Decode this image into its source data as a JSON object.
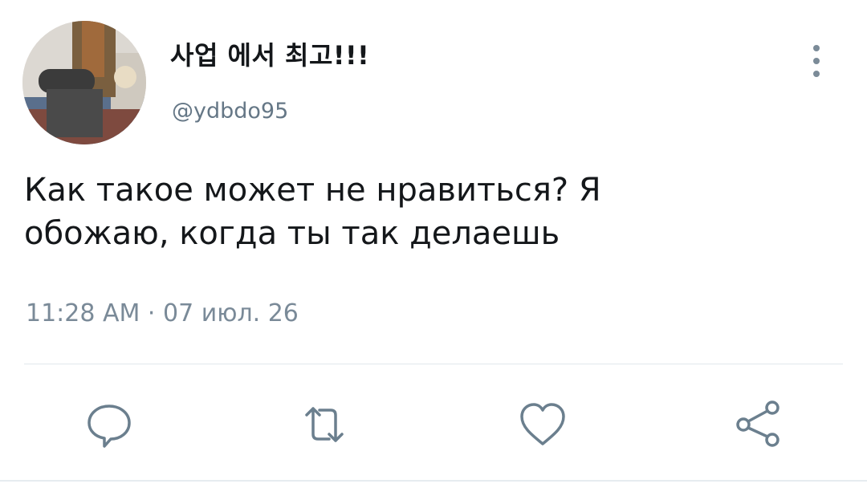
{
  "tweet": {
    "display_name": "사업 에서 최고!!!",
    "handle": "@ydbdo95",
    "text_line1": "Как такое может не нравиться? Я",
    "text_line2": "обожаю, когда ты так делаешь",
    "timestamp": "11:28 AM · 07 июл. 26"
  },
  "icons": {
    "menu": "more-vertical-icon",
    "reply": "reply-icon",
    "retweet": "retweet-icon",
    "like": "heart-icon",
    "share": "share-icon"
  },
  "colors": {
    "text": "#14171a",
    "secondary": "#657786",
    "icon": "#6b7f8e",
    "divider": "#e1e8ed"
  }
}
